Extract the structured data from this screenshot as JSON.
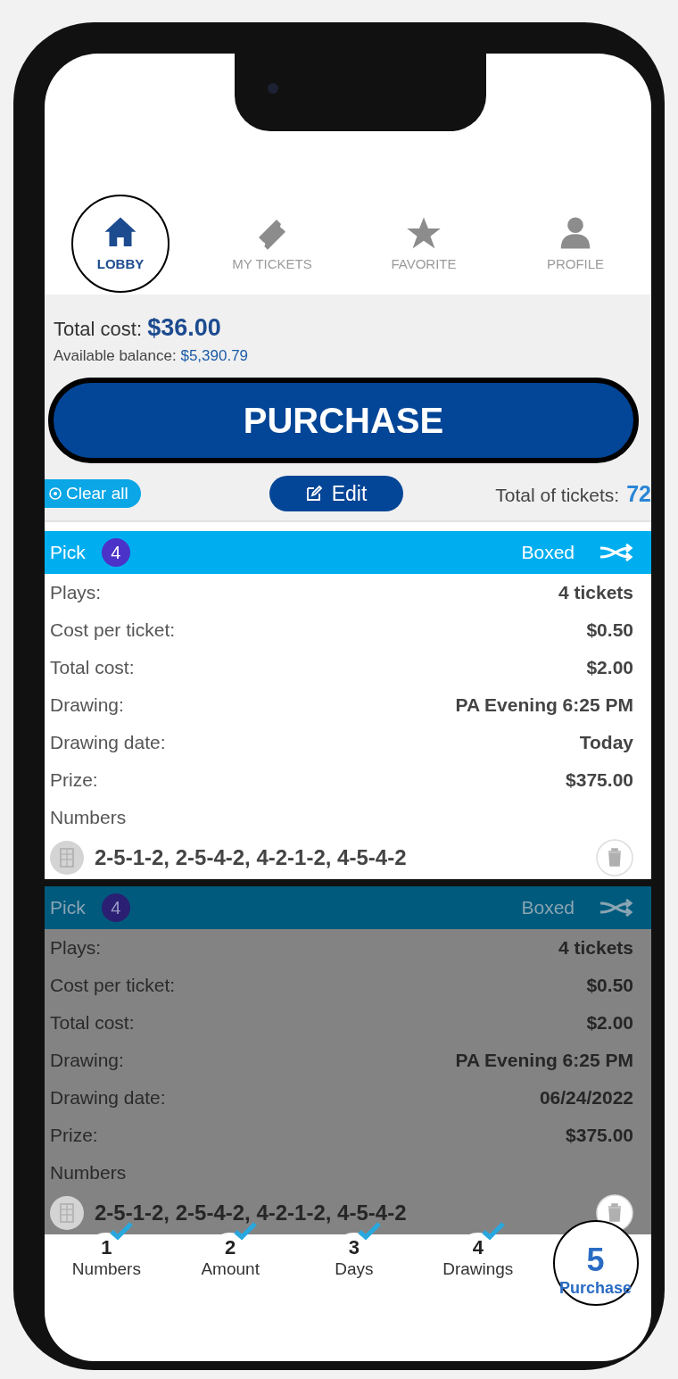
{
  "nav_tabs": [
    {
      "label": "LOBBY",
      "selected": true
    },
    {
      "label": "MY TICKETS",
      "selected": false
    },
    {
      "label": "FAVORITE",
      "selected": false
    },
    {
      "label": "PROFILE",
      "selected": false
    }
  ],
  "summary": {
    "total_cost_label": "Total cost:",
    "total_cost": "$36.00",
    "balance_label": "Available balance:",
    "balance": "$5,390.79"
  },
  "purchase_button": "PURCHASE",
  "actions": {
    "clear_all": "Clear all",
    "edit": "Edit",
    "total_tickets_label": "Total of tickets:",
    "total_tickets": "72"
  },
  "tickets": [
    {
      "game": "Pick",
      "badge": "4",
      "type": "Boxed",
      "dimmed": false,
      "rows": [
        {
          "label": "Plays:",
          "value": "4 tickets"
        },
        {
          "label": "Cost per ticket:",
          "value": "$0.50"
        },
        {
          "label": "Total cost:",
          "value": "$2.00"
        },
        {
          "label": "Drawing:",
          "value": "PA Evening 6:25 PM"
        },
        {
          "label": "Drawing date:",
          "value": "Today"
        },
        {
          "label": "Prize:",
          "value": "$375.00"
        }
      ],
      "numbers_label": "Numbers",
      "numbers": "2-5-1-2,  2-5-4-2,  4-2-1-2,  4-5-4-2"
    },
    {
      "game": "Pick",
      "badge": "4",
      "type": "Boxed",
      "dimmed": true,
      "rows": [
        {
          "label": "Plays:",
          "value": "4 tickets"
        },
        {
          "label": "Cost per ticket:",
          "value": "$0.50"
        },
        {
          "label": "Total cost:",
          "value": "$2.00"
        },
        {
          "label": "Drawing:",
          "value": "PA Evening 6:25 PM"
        },
        {
          "label": "Drawing date:",
          "value": "06/24/2022"
        },
        {
          "label": "Prize:",
          "value": "$375.00"
        }
      ],
      "numbers_label": "Numbers",
      "numbers": "2-5-1-2,  2-5-4-2,  4-2-1-2,  4-5-4-2"
    }
  ],
  "steps": [
    {
      "number": "1",
      "label": "Numbers",
      "done": true,
      "selected": false
    },
    {
      "number": "2",
      "label": "Amount",
      "done": true,
      "selected": false
    },
    {
      "number": "3",
      "label": "Days",
      "done": true,
      "selected": false
    },
    {
      "number": "4",
      "label": "Drawings",
      "done": true,
      "selected": false
    },
    {
      "number": "5",
      "label": "Purchase",
      "done": false,
      "selected": true
    }
  ]
}
